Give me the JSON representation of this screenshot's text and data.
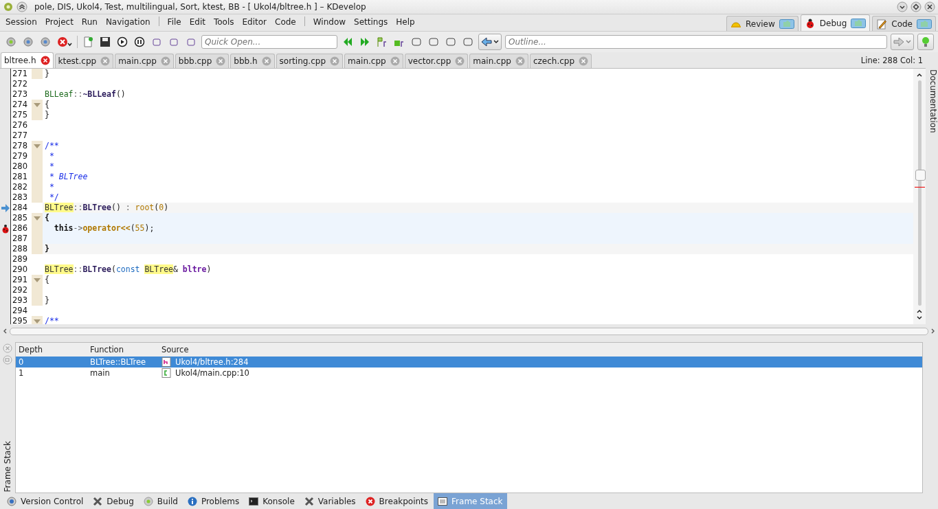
{
  "window": {
    "title": "pole, DIS, Ukol4, Test, multilingual, Sort, ktest, BB - [ Ukol4/bltree.h ] – KDevelop"
  },
  "menu": [
    {
      "label": "Session",
      "separator_before": false
    },
    {
      "label": "Project",
      "separator_before": false
    },
    {
      "label": "Run",
      "separator_before": false
    },
    {
      "label": "Navigation",
      "separator_before": false
    },
    {
      "label": "File",
      "separator_before": true
    },
    {
      "label": "Edit",
      "separator_before": false
    },
    {
      "label": "Tools",
      "separator_before": false
    },
    {
      "label": "Editor",
      "separator_before": false
    },
    {
      "label": "Code",
      "separator_before": false
    },
    {
      "label": "Window",
      "separator_before": true
    },
    {
      "label": "Settings",
      "separator_before": false
    },
    {
      "label": "Help",
      "separator_before": false
    }
  ],
  "perspectives": [
    {
      "label": "Review",
      "kind": "review",
      "selected": false
    },
    {
      "label": "Debug",
      "kind": "debug",
      "selected": true
    },
    {
      "label": "Code",
      "kind": "code",
      "selected": false
    }
  ],
  "quick_open": {
    "placeholder": "Quick Open..."
  },
  "outline": {
    "placeholder": "Outline..."
  },
  "tabs": [
    {
      "label": "bltree.h",
      "selected": true
    },
    {
      "label": "ktest.cpp",
      "selected": false
    },
    {
      "label": "main.cpp",
      "selected": false
    },
    {
      "label": "bbb.cpp",
      "selected": false
    },
    {
      "label": "bbb.h",
      "selected": false
    },
    {
      "label": "sorting.cpp",
      "selected": false
    },
    {
      "label": "main.cpp",
      "selected": false
    },
    {
      "label": "vector.cpp",
      "selected": false
    },
    {
      "label": "main.cpp",
      "selected": false
    },
    {
      "label": "czech.cpp",
      "selected": false
    }
  ],
  "cursor_position": "Line: 288 Col: 1",
  "side_panel": "Documentation",
  "code_lines": [
    {
      "number": "271",
      "fold_start": false,
      "in_block": true,
      "tokens": [
        {
          "text": "}",
          "kind": "plain"
        }
      ]
    },
    {
      "number": "272",
      "fold_start": false,
      "in_block": false
    },
    {
      "number": "273",
      "fold_start": false,
      "in_block": false,
      "tokens": [
        {
          "text": "BLLeaf",
          "kind": "type"
        },
        {
          "text": "::",
          "kind": "op"
        },
        {
          "text": "~BLLeaf",
          "kind": "func"
        },
        {
          "text": "()",
          "kind": "plain"
        }
      ]
    },
    {
      "number": "274",
      "fold_start": true,
      "in_block": true,
      "tokens": [
        {
          "text": "{",
          "kind": "plain"
        }
      ]
    },
    {
      "number": "275",
      "fold_start": false,
      "in_block": true,
      "tokens": [
        {
          "text": "}",
          "kind": "plain"
        }
      ]
    },
    {
      "number": "276",
      "fold_start": false,
      "in_block": false
    },
    {
      "number": "277",
      "fold_start": false,
      "in_block": false
    },
    {
      "number": "278",
      "fold_start": true,
      "in_block": true,
      "tokens": [
        {
          "text": "/**",
          "kind": "comment"
        }
      ]
    },
    {
      "number": "279",
      "fold_start": false,
      "in_block": true,
      "tokens": [
        {
          "text": " *",
          "kind": "comment"
        }
      ]
    },
    {
      "number": "280",
      "fold_start": false,
      "in_block": true,
      "tokens": [
        {
          "text": " *",
          "kind": "comment"
        }
      ]
    },
    {
      "number": "281",
      "fold_start": false,
      "in_block": true,
      "tokens": [
        {
          "text": " * ",
          "kind": "comment"
        },
        {
          "text": "BLTree",
          "kind": "doc"
        }
      ]
    },
    {
      "number": "282",
      "fold_start": false,
      "in_block": true,
      "tokens": [
        {
          "text": " *",
          "kind": "comment"
        }
      ]
    },
    {
      "number": "283",
      "fold_start": false,
      "in_block": true,
      "tokens": [
        {
          "text": " */",
          "kind": "comment"
        }
      ]
    },
    {
      "number": "284",
      "fold_start": false,
      "in_block": false,
      "execution_point": true,
      "kind": "exec",
      "tokens": [
        {
          "text": "BLTree",
          "kind": "hl"
        },
        {
          "text": "::",
          "kind": "op"
        },
        {
          "text": "BLTree",
          "kind": "func"
        },
        {
          "text": "() ",
          "kind": "plain"
        },
        {
          "text": ":",
          "kind": "op"
        },
        {
          "text": " root",
          "kind": "member"
        },
        {
          "text": "(",
          "kind": "plain"
        },
        {
          "text": "0",
          "kind": "member"
        },
        {
          "text": ")",
          "kind": "plain"
        }
      ]
    },
    {
      "number": "285",
      "fold_start": true,
      "in_block": true,
      "kind": "scope",
      "tokens": [
        {
          "text": "{",
          "kind": "bold"
        }
      ]
    },
    {
      "number": "286",
      "fold_start": false,
      "in_block": true,
      "breakpoint": true,
      "kind": "scope",
      "tokens": [
        {
          "text": "  this",
          "kind": "bold"
        },
        {
          "text": "->",
          "kind": "op"
        },
        {
          "text": "operator<<",
          "kind": "memberbold"
        },
        {
          "text": "(",
          "kind": "plain"
        },
        {
          "text": "55",
          "kind": "member"
        },
        {
          "text": ");",
          "kind": "plain"
        }
      ]
    },
    {
      "number": "287",
      "fold_start": false,
      "in_block": true,
      "kind": "scope"
    },
    {
      "number": "288",
      "fold_start": false,
      "in_block": true,
      "kind": "current",
      "tokens": [
        {
          "text": "}",
          "kind": "bold"
        }
      ]
    },
    {
      "number": "289",
      "fold_start": false,
      "in_block": false
    },
    {
      "number": "290",
      "fold_start": false,
      "in_block": false,
      "tokens": [
        {
          "text": "BLTree",
          "kind": "hl"
        },
        {
          "text": "::",
          "kind": "op"
        },
        {
          "text": "BLTree",
          "kind": "func"
        },
        {
          "text": "(",
          "kind": "plain"
        },
        {
          "text": "const ",
          "kind": "keyword"
        },
        {
          "text": "BLTree",
          "kind": "hl"
        },
        {
          "text": "& ",
          "kind": "plain"
        },
        {
          "text": "bltre",
          "kind": "param"
        },
        {
          "text": ")",
          "kind": "plain"
        }
      ]
    },
    {
      "number": "291",
      "fold_start": true,
      "in_block": true,
      "tokens": [
        {
          "text": "{",
          "kind": "plain"
        }
      ]
    },
    {
      "number": "292",
      "fold_start": false,
      "in_block": true
    },
    {
      "number": "293",
      "fold_start": false,
      "in_block": true,
      "tokens": [
        {
          "text": "}",
          "kind": "plain"
        }
      ]
    },
    {
      "number": "294",
      "fold_start": false,
      "in_block": false
    },
    {
      "number": "295",
      "fold_start": true,
      "in_block": true,
      "tokens": [
        {
          "text": "/**",
          "kind": "comment"
        }
      ]
    }
  ],
  "frame_stack": {
    "columns": [
      "Depth",
      "Function",
      "Source"
    ],
    "rows": [
      {
        "depth": "0",
        "function": "BLTree::BLTree",
        "kind": "header",
        "source": "Ukol4/bltree.h:284",
        "selected": true
      },
      {
        "depth": "1",
        "function": "main",
        "kind": "cpp",
        "source": "Ukol4/main.cpp:10",
        "selected": false
      }
    ],
    "side_label": "Frame Stack"
  },
  "tool_views": [
    {
      "label": "Version Control",
      "kind": "vcs",
      "selected": false
    },
    {
      "label": "Debug",
      "kind": "tools",
      "selected": false
    },
    {
      "label": "Build",
      "kind": "gear",
      "selected": false
    },
    {
      "label": "Problems",
      "kind": "info",
      "selected": false
    },
    {
      "label": "Konsole",
      "kind": "terminal",
      "selected": false
    },
    {
      "label": "Variables",
      "kind": "tools",
      "selected": false
    },
    {
      "label": "Breakpoints",
      "kind": "stop",
      "selected": false
    },
    {
      "label": "Frame Stack",
      "kind": "table",
      "selected": true
    }
  ]
}
